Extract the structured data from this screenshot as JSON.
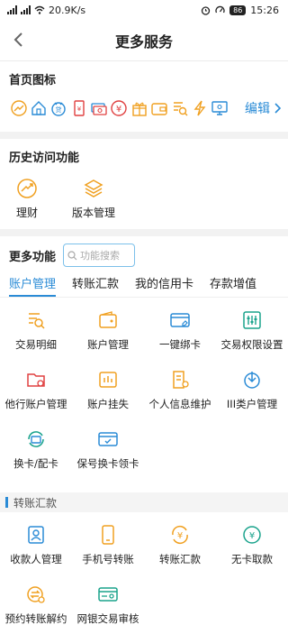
{
  "status": {
    "network": "20.9K/s",
    "battery": "86",
    "time": "15:26"
  },
  "nav": {
    "title": "更多服务"
  },
  "home_icons": {
    "title": "首页图标",
    "edit_label": "编辑"
  },
  "history": {
    "title": "历史访问功能",
    "items": [
      {
        "label": "理财",
        "icon": "trend-icon"
      },
      {
        "label": "版本管理",
        "icon": "layers-icon"
      }
    ]
  },
  "more": {
    "title": "更多功能",
    "search_placeholder": "功能搜索",
    "tabs": [
      "账户管理",
      "转账汇款",
      "我的信用卡",
      "存款增值"
    ],
    "account_items": [
      {
        "label": "交易明细"
      },
      {
        "label": "账户管理"
      },
      {
        "label": "一键绑卡"
      },
      {
        "label": "交易权限设置"
      },
      {
        "label": "他行账户管理"
      },
      {
        "label": "账户挂失"
      },
      {
        "label": "个人信息维护"
      },
      {
        "label": "III类户管理"
      },
      {
        "label": "换卡/配卡"
      },
      {
        "label": "保号换卡领卡"
      }
    ],
    "transfer_section": "转账汇款",
    "transfer_items": [
      {
        "label": "收款人管理"
      },
      {
        "label": "手机号转账"
      },
      {
        "label": "转账汇款"
      },
      {
        "label": "无卡取款"
      },
      {
        "label": "预约转账解约"
      },
      {
        "label": "网银交易审核"
      }
    ]
  },
  "colors": {
    "accent": "#2a8bd6",
    "orange": "#f0a020",
    "red": "#e04040"
  }
}
